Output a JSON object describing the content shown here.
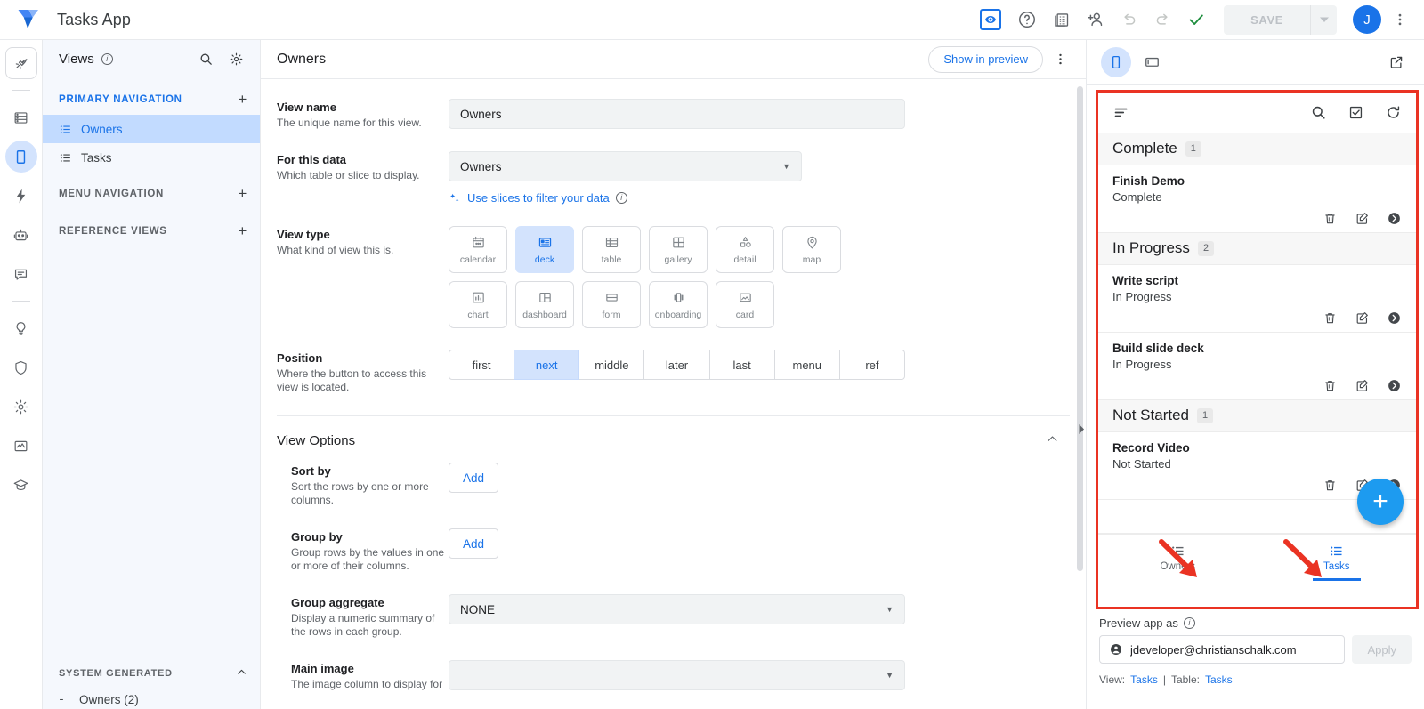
{
  "topbar": {
    "app_title": "Tasks App",
    "save_label": "SAVE",
    "avatar_initial": "J",
    "icons": [
      "preview-eye-icon",
      "help-icon",
      "table-icon",
      "add-person-icon",
      "undo-icon",
      "redo-icon",
      "check-icon"
    ]
  },
  "rail": {
    "items": [
      {
        "name": "rocket-icon"
      },
      {
        "name": "data-icon"
      },
      {
        "name": "app-device-icon"
      },
      {
        "name": "automation-icon"
      },
      {
        "name": "chatbot-icon"
      },
      {
        "name": "chat-icon"
      },
      {
        "name": "intelligence-icon"
      },
      {
        "name": "security-icon"
      },
      {
        "name": "settings-icon"
      },
      {
        "name": "monitor-icon"
      },
      {
        "name": "learn-icon"
      }
    ]
  },
  "sidebar": {
    "title": "Views",
    "sections": [
      {
        "label": "PRIMARY NAVIGATION",
        "plus": "+"
      },
      {
        "label": "MENU NAVIGATION",
        "plus": "+"
      },
      {
        "label": "REFERENCE VIEWS",
        "plus": "+"
      }
    ],
    "views": [
      {
        "label": "Owners",
        "active": true
      },
      {
        "label": "Tasks",
        "active": false
      }
    ],
    "system_generated": {
      "label": "SYSTEM GENERATED",
      "first_item": "Owners (2)"
    }
  },
  "main": {
    "title": "Owners",
    "show_in_preview": "Show in preview",
    "fields": {
      "view_name": {
        "title": "View name",
        "desc": "The unique name for this view.",
        "value": "Owners"
      },
      "for_this_data": {
        "title": "For this data",
        "desc": "Which table or slice to display.",
        "value": "Owners",
        "slices_link": "Use slices to filter your data"
      },
      "view_type": {
        "title": "View type",
        "desc": "What kind of view this is.",
        "options": [
          {
            "label": "calendar",
            "icon": "calendar-icon",
            "active": false
          },
          {
            "label": "deck",
            "icon": "deck-icon",
            "active": true
          },
          {
            "label": "table",
            "icon": "table-icon",
            "active": false
          },
          {
            "label": "gallery",
            "icon": "gallery-icon",
            "active": false
          },
          {
            "label": "detail",
            "icon": "detail-icon",
            "active": false
          },
          {
            "label": "map",
            "icon": "map-pin-icon",
            "active": false
          },
          {
            "label": "chart",
            "icon": "chart-icon",
            "active": false
          },
          {
            "label": "dashboard",
            "icon": "dashboard-icon",
            "active": false
          },
          {
            "label": "form",
            "icon": "form-icon",
            "active": false
          },
          {
            "label": "onboarding",
            "icon": "onboarding-icon",
            "active": false
          },
          {
            "label": "card",
            "icon": "card-icon",
            "active": false
          }
        ]
      },
      "position": {
        "title": "Position",
        "desc": "Where the button to access this view is located.",
        "options": [
          {
            "label": "first",
            "active": false
          },
          {
            "label": "next",
            "active": true
          },
          {
            "label": "middle",
            "active": false
          },
          {
            "label": "later",
            "active": false
          },
          {
            "label": "last",
            "active": false
          },
          {
            "label": "menu",
            "active": false
          },
          {
            "label": "ref",
            "active": false
          }
        ]
      }
    },
    "view_options": {
      "title": "View Options",
      "sort_by": {
        "title": "Sort by",
        "desc": "Sort the rows by one or more columns.",
        "button": "Add"
      },
      "group_by": {
        "title": "Group by",
        "desc": "Group rows by the values in one or more of their columns.",
        "button": "Add"
      },
      "group_aggregate": {
        "title": "Group aggregate",
        "desc": "Display a numeric summary of the rows in each group.",
        "value": "NONE"
      },
      "main_image": {
        "title": "Main image",
        "desc": "The image column to display for",
        "value": ""
      }
    }
  },
  "preview": {
    "toolbar": {
      "phone": "phone-icon",
      "tablet": "tablet-icon",
      "open_external": "open-in-new-icon"
    },
    "app_bar": {
      "menu": "sort-menu-icon",
      "search": "search-icon",
      "select": "checkbox-icon",
      "refresh": "refresh-icon"
    },
    "groups": [
      {
        "name": "Complete",
        "count": "1",
        "tasks": [
          {
            "title": "Finish Demo",
            "status": "Complete"
          }
        ]
      },
      {
        "name": "In Progress",
        "count": "2",
        "tasks": [
          {
            "title": "Write script",
            "status": "In Progress"
          },
          {
            "title": "Build slide deck",
            "status": "In Progress"
          }
        ]
      },
      {
        "name": "Not Started",
        "count": "1",
        "tasks": [
          {
            "title": "Record Video",
            "status": "Not Started"
          }
        ]
      }
    ],
    "row_actions": [
      "delete-icon",
      "edit-icon",
      "navigate-icon"
    ],
    "fab_label": "+",
    "bottom_nav": [
      {
        "label": "Owners",
        "active": false
      },
      {
        "label": "Tasks",
        "active": true
      }
    ],
    "footer": {
      "preview_as_label": "Preview app as",
      "user_email": "jdeveloper@christianschalk.com",
      "apply_label": "Apply",
      "view_prefix": "View:",
      "view_value": "Tasks",
      "separator": "|",
      "table_prefix": "Table:",
      "table_value": "Tasks"
    }
  },
  "colors": {
    "accent": "#1a73e8",
    "accent_soft": "#d3e3fd",
    "annotation": "#ea3323",
    "fab": "#1d9bf0",
    "success": "#1e8e3e"
  }
}
